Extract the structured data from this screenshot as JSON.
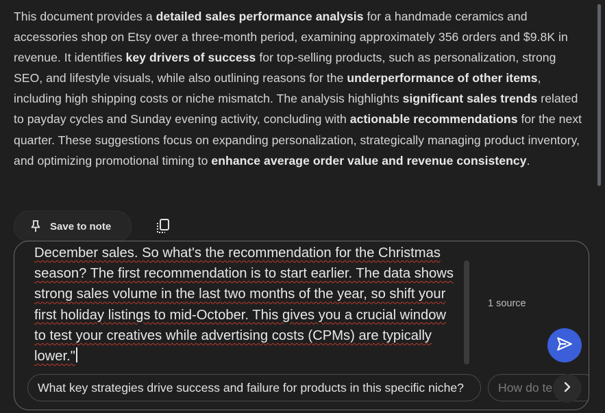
{
  "summary": {
    "p1": "This document provides a ",
    "b1": "detailed sales performance analysis",
    "p2": " for a handmade ceramics and accessories shop on Etsy over a three-month period, examining approximately 356 orders and $9.8K in revenue. It identifies ",
    "b2": "key drivers of success",
    "p3": " for top-selling products, such as personalization, strong SEO, and lifestyle visuals, while also outlining reasons for the ",
    "b3": "underperformance of other items",
    "p4": ", including high shipping costs or niche mismatch. The analysis highlights ",
    "b4": "significant sales trends",
    "p5": " related to payday cycles and Sunday evening activity, concluding with ",
    "b5": "actionable recommendations",
    "p6": " for the next quarter. These suggestions focus on expanding personalization, strategically managing product inventory, and optimizing promotional timing to ",
    "b6": "enhance average order value and revenue consistency",
    "p7": "."
  },
  "actions": {
    "save_note_label": "Save to note",
    "pin_icon": "pin-icon",
    "copy_icon": "copy-icon"
  },
  "chat": {
    "input_value": "December sales. So what's the recommendation for the Christmas season? The first recommendation is to start earlier. The data shows strong sales volume in the last two months of the year, so shift your first holiday listings to mid-October. This gives you a crucial window to test your creatives while advertising costs (CPMs) are typically lower.\"",
    "source_count": "1 source",
    "send_icon": "send-icon"
  },
  "suggestions": [
    {
      "label": "What key strategies drive success and failure for products in this specific niche?"
    },
    {
      "label": "How do te"
    }
  ],
  "colors": {
    "background": "#1f1f1f",
    "send_button": "#3a5fd9",
    "spellcheck": "#c0392b"
  }
}
